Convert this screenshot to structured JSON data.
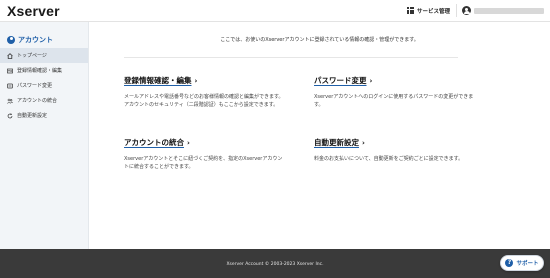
{
  "header": {
    "logo": "Xserver",
    "service_menu_label": "サービス管理",
    "kebab": "⋮"
  },
  "sidebar": {
    "title": "アカウント",
    "items": [
      {
        "label": "トップページ",
        "icon": "home-icon",
        "active": true
      },
      {
        "label": "登録情報確認・編集",
        "icon": "id-card-icon",
        "active": false
      },
      {
        "label": "パスワード変更",
        "icon": "key-icon",
        "active": false
      },
      {
        "label": "アカウントの統合",
        "icon": "users-icon",
        "active": false
      },
      {
        "label": "自動更新設定",
        "icon": "refresh-icon",
        "active": false
      }
    ]
  },
  "main": {
    "intro": "ここでは、お使いのXserverアカウントに登録されている情報の確認・管理ができます。",
    "cards": [
      {
        "title": "登録情報確認・編集",
        "description": "メールアドレスや電話番号などのお客様情報の確認と編集ができます。アカウントのセキュリティ（二段階認証）もここから設定できます。"
      },
      {
        "title": "パスワード変更",
        "description": "Xserverアカウントへのログインに使用するパスワードの変更ができます。"
      },
      {
        "title": "アカウントの統合",
        "description": "Xserverアカウントとそこに紐づくご契約を、指定のXserverアカウントに統合することができます。"
      },
      {
        "title": "自動更新設定",
        "description": "料金のお支払いについて、自動更新をご契約ごとに設定できます。"
      }
    ]
  },
  "footer": {
    "copyright": "Xserver Account © 2003-2023 Xserver Inc.",
    "support_label": "サポート",
    "support_icon_glyph": "?"
  },
  "colors": {
    "accent": "#1f5fa8",
    "footer_bg": "#3a3a3a",
    "sidebar_bg": "#f2f5f8"
  }
}
